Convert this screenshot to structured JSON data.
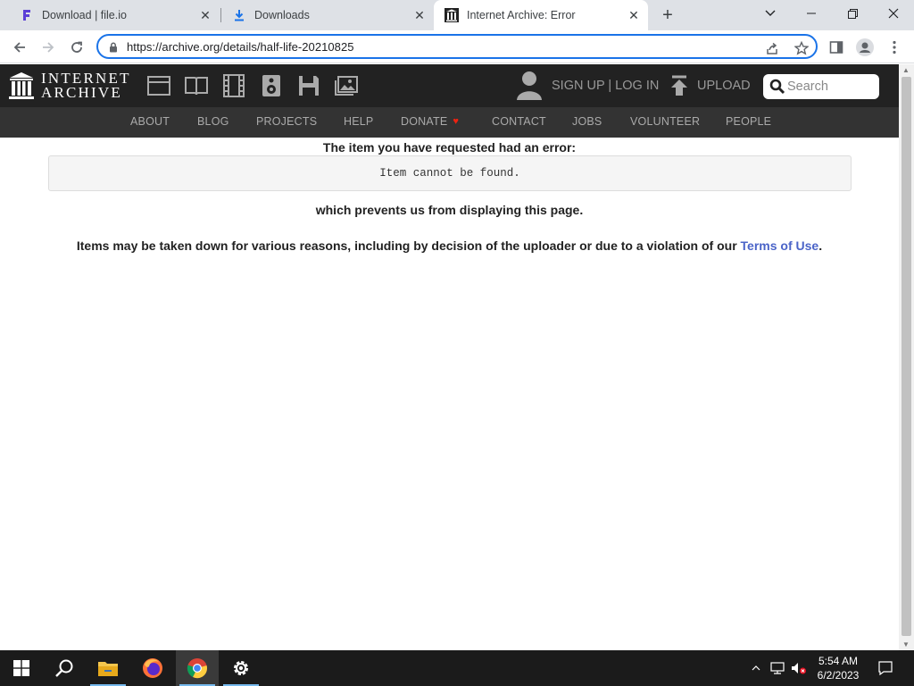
{
  "browser": {
    "tabs": [
      {
        "title": "Download | file.io",
        "favicon": "fileio-icon",
        "active": false
      },
      {
        "title": "Downloads",
        "favicon": "download-icon",
        "active": false
      },
      {
        "title": "Internet Archive: Error",
        "favicon": "archive-icon",
        "active": true
      }
    ],
    "url": "https://archive.org/details/half-life-20210825"
  },
  "ia": {
    "logo_line1": "INTERNET",
    "logo_line2": "ARCHIVE",
    "media_icons": [
      "web-icon",
      "texts-icon",
      "video-icon",
      "audio-icon",
      "software-icon",
      "images-icon"
    ],
    "signup_label": "SIGN UP | LOG IN",
    "upload_label": "UPLOAD",
    "search_placeholder": "Search",
    "subnav": [
      "ABOUT",
      "BLOG",
      "PROJECTS",
      "HELP",
      "DONATE",
      "CONTACT",
      "JOBS",
      "VOLUNTEER",
      "PEOPLE"
    ]
  },
  "page": {
    "error_heading": "The item you have requested had an error:",
    "error_message": "Item cannot be found.",
    "prevents_text": "which prevents us from displaying this page.",
    "takedown_text": "Items may be taken down for various reasons, including by decision of the uploader or due to a violation of our",
    "terms_link": "Terms of Use",
    "terms_period": "."
  },
  "taskbar": {
    "time": "5:54 AM",
    "date": "6/2/2023",
    "apps": [
      "start-icon",
      "search-icon",
      "file-explorer-icon",
      "firefox-icon",
      "chrome-icon",
      "settings-icon"
    ]
  },
  "colors": {
    "accent": "#1a73e8",
    "ia_dark": "#222222",
    "ia_subnav": "#333333",
    "link": "#4b64c8"
  }
}
